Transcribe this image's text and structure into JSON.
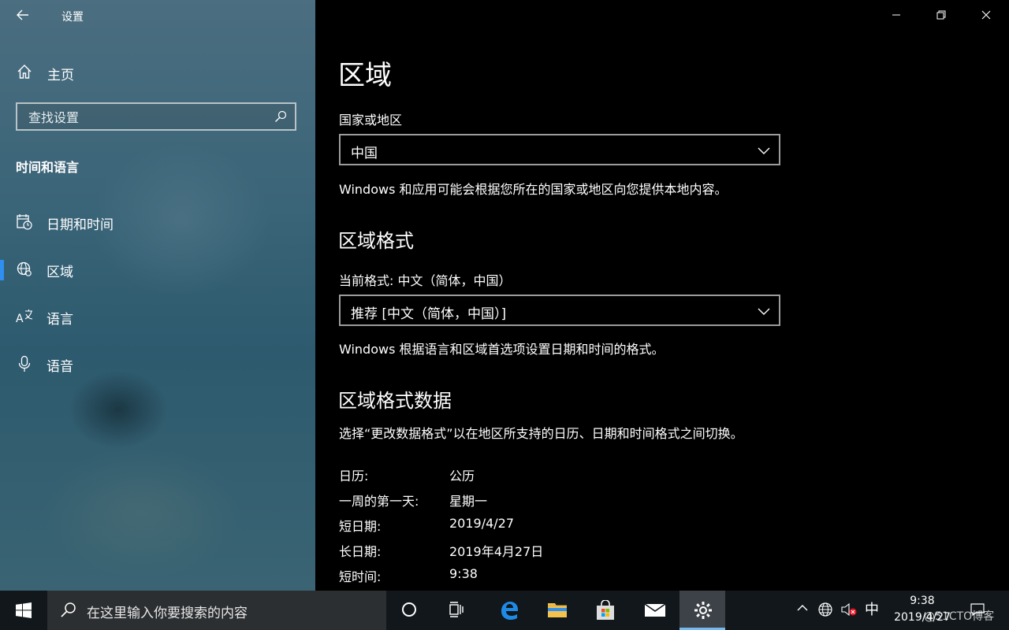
{
  "window": {
    "title": "设置"
  },
  "sidebar": {
    "home_label": "主页",
    "search_placeholder": "查找设置",
    "section_title": "时间和语言",
    "items": [
      {
        "label": "日期和时间",
        "icon": "calendar-clock-icon",
        "selected": false
      },
      {
        "label": "区域",
        "icon": "globe-icon",
        "selected": true
      },
      {
        "label": "语言",
        "icon": "language-icon",
        "selected": false
      },
      {
        "label": "语音",
        "icon": "microphone-icon",
        "selected": false
      }
    ]
  },
  "main": {
    "title": "区域",
    "country": {
      "label": "国家或地区",
      "value": "中国",
      "description": "Windows 和应用可能会根据您所在的国家或地区向您提供本地内容。"
    },
    "format": {
      "heading": "区域格式",
      "current_label": "当前格式: 中文（简体，中国）",
      "value": "推荐 [中文（简体，中国）]",
      "description": "Windows 根据语言和区域首选项设置日期和时间的格式。"
    },
    "format_data": {
      "heading": "区域格式数据",
      "description": "选择“更改数据格式”以在地区所支持的日历、日期和时间格式之间切换。",
      "rows": [
        {
          "key": "日历:",
          "value": "公历"
        },
        {
          "key": "一周的第一天:",
          "value": "星期一"
        },
        {
          "key": "短日期:",
          "value": "2019/4/27"
        },
        {
          "key": "长日期:",
          "value": "2019年4月27日"
        },
        {
          "key": "短时间:",
          "value": "9:38"
        }
      ]
    }
  },
  "taskbar": {
    "search_placeholder": "在这里输入你要搜索的内容",
    "ime": "中",
    "time": "9:38",
    "date": "2019/4/27",
    "watermark": "@51CTO博客"
  },
  "colors": {
    "accent": "#2f8ff0",
    "edge_blue": "#1f8ae6",
    "folder_yellow": "#f2c14e"
  }
}
